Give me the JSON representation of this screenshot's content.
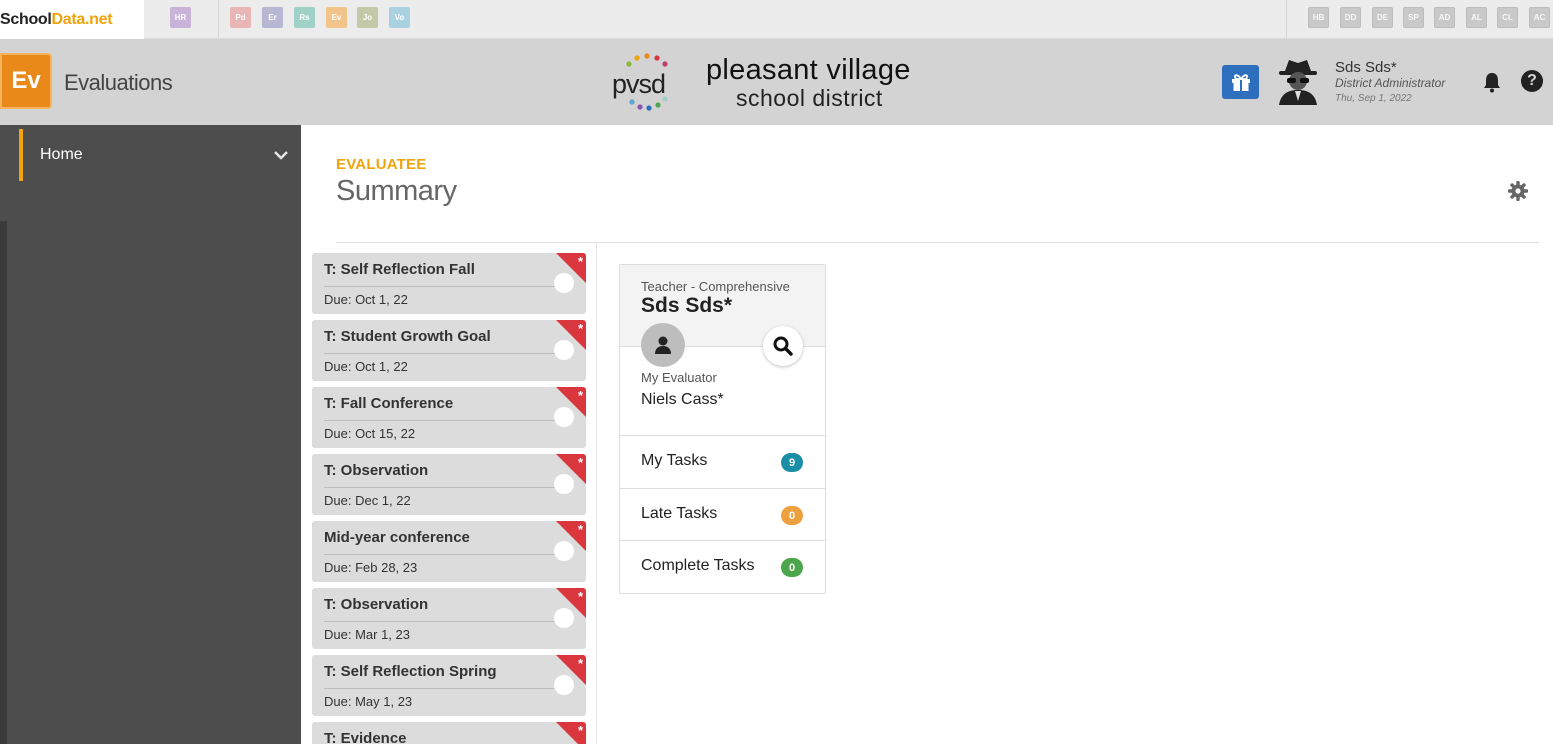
{
  "brand": {
    "part1": "School",
    "part2": "Data.net"
  },
  "app_switcher": {
    "left": [
      {
        "label": "HR",
        "color": "#c9b3d9"
      }
    ],
    "middle": [
      {
        "label": "Pd",
        "color": "#e9b5b5"
      },
      {
        "label": "Er",
        "color": "#b7b7d3"
      },
      {
        "label": "Rs",
        "color": "#9fd1c9"
      },
      {
        "label": "Ev",
        "color": "#f3c489"
      },
      {
        "label": "Jo",
        "color": "#c3c9a8"
      },
      {
        "label": "Vo",
        "color": "#a9d1e0"
      }
    ],
    "right": [
      "HB",
      "DD",
      "DE",
      "SP",
      "AD",
      "AL",
      "CL",
      "AC"
    ]
  },
  "header": {
    "app_logo": "Ev",
    "app_title": "Evaluations",
    "district_logo_text": "pvsd",
    "district_name": "pleasant village",
    "district_sub": "school district",
    "user": {
      "name": "Sds Sds*",
      "role": "District Administrator",
      "date": "Thu, Sep 1, 2022"
    },
    "help_label": "?"
  },
  "sidebar": {
    "items": [
      {
        "label": "Home"
      }
    ]
  },
  "main": {
    "label": "EVALUATEE",
    "title": "Summary",
    "tasks": [
      {
        "title": "T: Self Reflection Fall",
        "due": "Due: Oct 1, 22"
      },
      {
        "title": "T: Student Growth Goal",
        "due": "Due: Oct 1, 22"
      },
      {
        "title": "T: Fall Conference",
        "due": "Due: Oct 15, 22"
      },
      {
        "title": "T: Observation",
        "due": "Due: Dec 1, 22"
      },
      {
        "title": "Mid-year conference",
        "due": "Due: Feb 28, 23"
      },
      {
        "title": "T: Observation",
        "due": "Due: Mar 1, 23"
      },
      {
        "title": "T: Self Reflection Spring",
        "due": "Due: May 1, 23"
      },
      {
        "title": "T: Evidence",
        "due": ""
      }
    ],
    "task_flag_symbol": "*",
    "summary": {
      "type": "Teacher - Comprehensive",
      "name": "Sds Sds*",
      "evaluator_label": "My Evaluator",
      "evaluator_name": "Niels Cass*",
      "rows": [
        {
          "label": "My Tasks",
          "count": "9",
          "color": "#1a8ea6"
        },
        {
          "label": "Late Tasks",
          "count": "0",
          "color": "#eea03f"
        },
        {
          "label": "Complete Tasks",
          "count": "0",
          "color": "#4ca64c"
        }
      ]
    }
  },
  "colors": {
    "accent": "#f0a30a",
    "header_bg": "#d3d3d3",
    "sidebar_bg": "#4d4d4d",
    "flag_red": "#d9363e",
    "gift_blue": "#2d6fbd"
  }
}
